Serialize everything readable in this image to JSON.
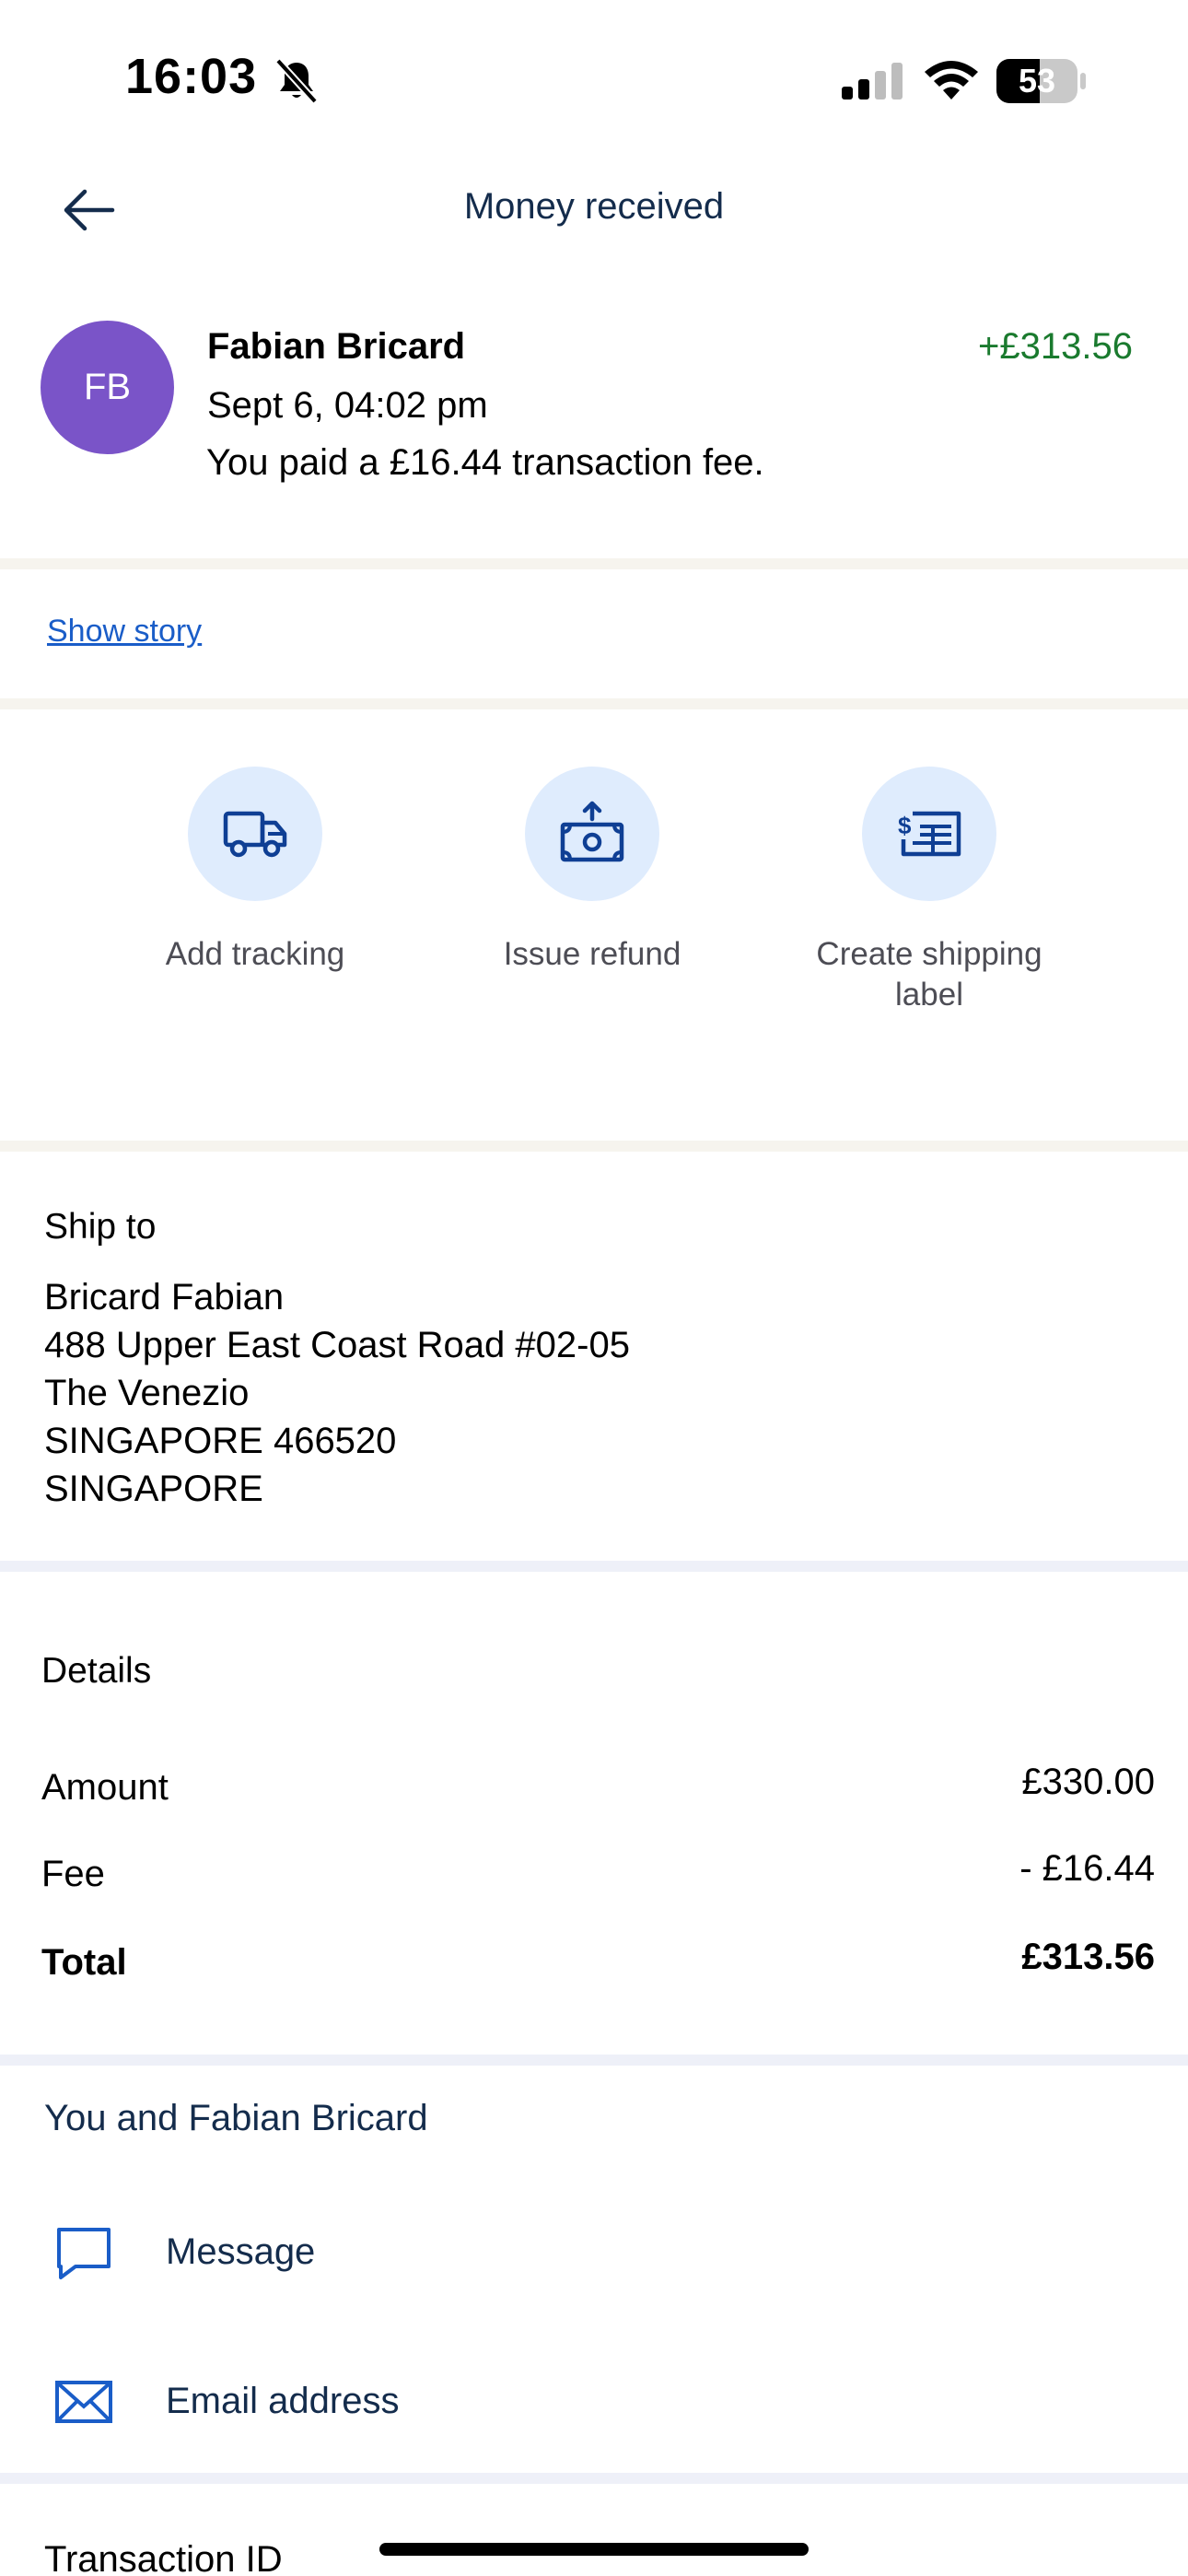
{
  "status_bar": {
    "time": "16:03",
    "battery_percent": "53",
    "battery_level": 0.53
  },
  "header": {
    "title": "Money received"
  },
  "transaction": {
    "avatar_initials": "FB",
    "name": "Fabian Bricard",
    "amount": "+£313.56",
    "date": "Sept 6, 04:02 pm",
    "fee_note": "You paid a £16.44 transaction fee."
  },
  "story_link": "Show story",
  "actions": [
    {
      "label": "Add tracking",
      "icon": "truck-icon"
    },
    {
      "label": "Issue refund",
      "icon": "refund-cash-icon"
    },
    {
      "label": "Create shipping label",
      "icon": "shipping-label-icon"
    }
  ],
  "ship_to": {
    "heading": "Ship to",
    "lines": [
      "Bricard Fabian",
      "488 Upper East Coast Road #02-05",
      "The Venezio",
      "SINGAPORE 466520",
      "SINGAPORE"
    ]
  },
  "details": {
    "heading": "Details",
    "rows": [
      {
        "label": "Amount",
        "value": "£330.00"
      },
      {
        "label": "Fee",
        "value": "- £16.44"
      },
      {
        "label": "Total",
        "value": "£313.56"
      }
    ]
  },
  "contact": {
    "heading": "You and Fabian Bricard",
    "message_label": "Message",
    "email_label": "Email address"
  },
  "transaction_id_label": "Transaction ID",
  "colors": {
    "avatar": "#7a54c8",
    "positive_amount": "#1a7a2e",
    "link": "#1a5dc8",
    "action_circle": "#dfecfd",
    "icon_blue": "#0f3f94"
  }
}
